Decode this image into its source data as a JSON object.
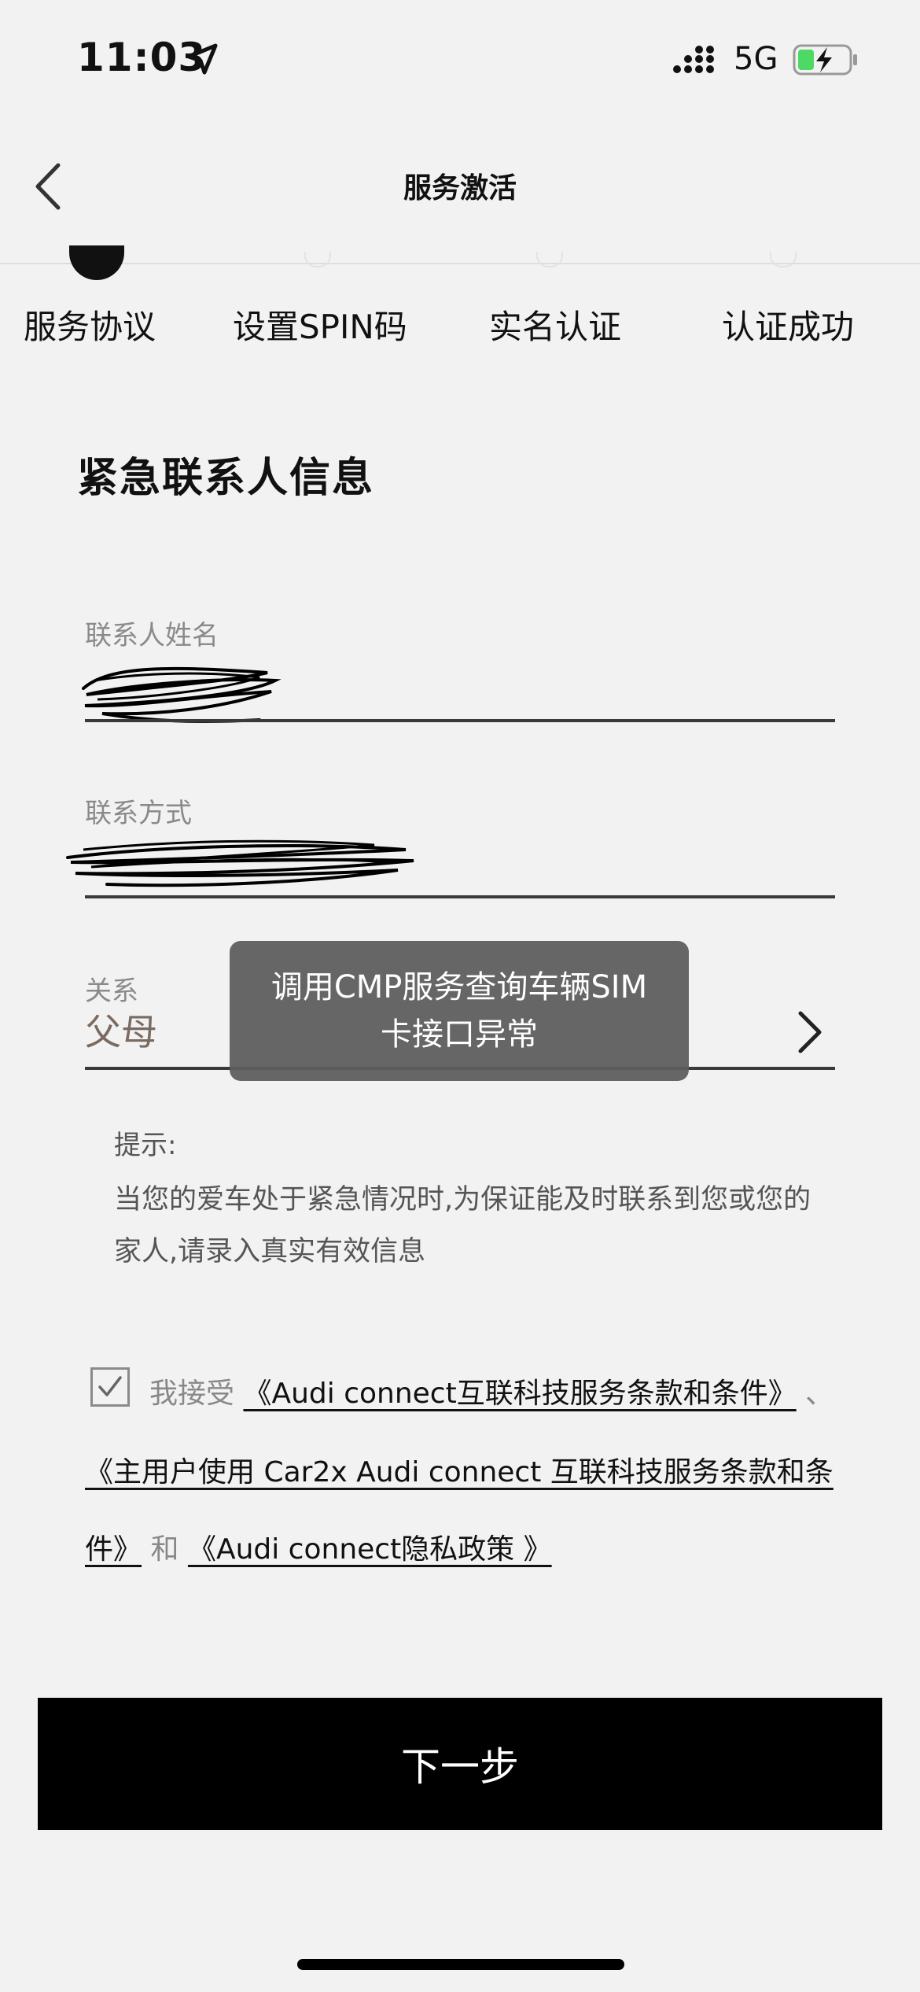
{
  "status_bar": {
    "time": "11:03",
    "network": "5G"
  },
  "nav": {
    "title": "服务激活"
  },
  "steps": [
    {
      "label": "服务协议",
      "state": "done"
    },
    {
      "label": "设置SPIN码",
      "state": "todo"
    },
    {
      "label": "实名认证",
      "state": "todo"
    },
    {
      "label": "认证成功",
      "state": "todo"
    }
  ],
  "section_title": "紧急联系人信息",
  "form": {
    "name_label": "联系人姓名",
    "contact_label": "联系方式",
    "relation_label": "关系",
    "relation_value": "父母"
  },
  "toast": {
    "line1": "调用CMP服务查询车辆SIM",
    "line2": "卡接口异常"
  },
  "tip": {
    "title": "提示:",
    "body": "当您的爱车处于紧急情况时,为保证能及时联系到您或您的家人,请录入真实有效信息"
  },
  "agreement": {
    "checked": true,
    "prefix": "我接受",
    "link1": "《Audi connect互联科技服务条款和条件》",
    "sep1": "、",
    "link2_part1": "《主用户使用 Car2x Audi connect 互联科技服务条款和条",
    "link2_part2": "件》",
    "conj": "和",
    "link3": "《Audi connect隐私政策 》"
  },
  "next_button": "下一步"
}
